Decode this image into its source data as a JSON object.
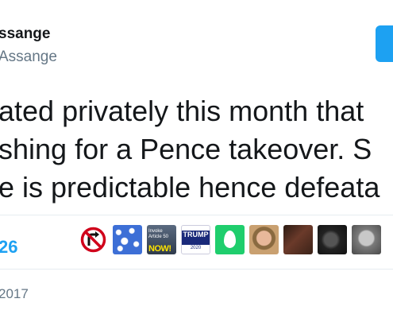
{
  "author": {
    "display_name": "ssange",
    "handle": "Assange"
  },
  "tweet": {
    "lines": [
      "ated privately this month that",
      "shing for a Pence takeover. S",
      "e is predictable hence defeata"
    ]
  },
  "stats": {
    "likes_count": "26"
  },
  "likers": [
    {
      "icon": "no-right-turn-sign-icon"
    },
    {
      "icon": "blue-bubbles-avatar"
    },
    {
      "icon": "article-50-now-avatar",
      "text_small": "Invoke Article 50",
      "text_big": "NOW!"
    },
    {
      "icon": "trump-2020-avatar",
      "text_big": "TRUMP",
      "text_small": "2020"
    },
    {
      "icon": "default-egg-avatar"
    },
    {
      "icon": "woman-portrait-avatar"
    },
    {
      "icon": "group-photo-avatar"
    },
    {
      "icon": "dark-portrait-avatar"
    },
    {
      "icon": "man-portrait-avatar"
    }
  ],
  "footer": {
    "date": "2017"
  },
  "colors": {
    "accent": "#1da1f2",
    "text_primary": "#14171a",
    "text_secondary": "#657786",
    "divider": "#e6ecf0"
  }
}
